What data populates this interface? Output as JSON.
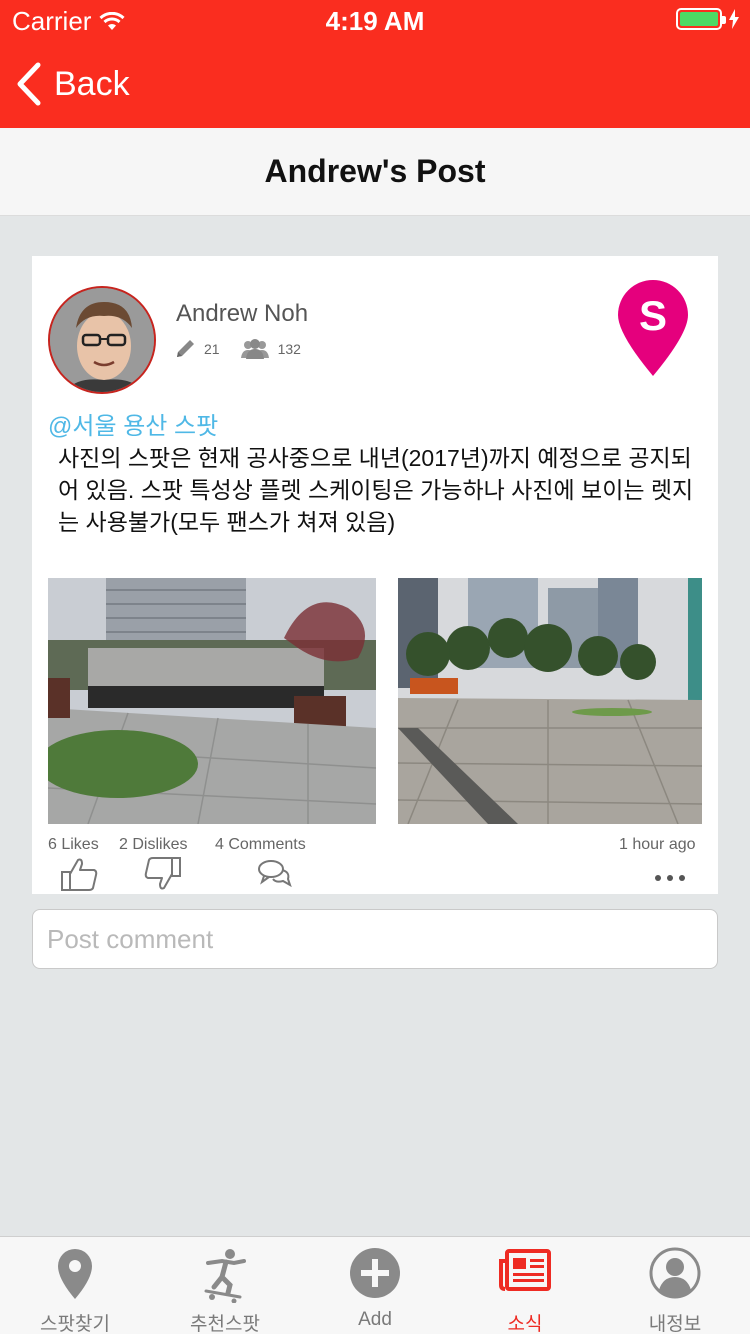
{
  "status_bar": {
    "carrier": "Carrier",
    "time": "4:19 AM"
  },
  "nav": {
    "back_label": "Back",
    "title": "Andrew's Post"
  },
  "post": {
    "author": "Andrew Noh",
    "posts_count": "21",
    "followers_count": "132",
    "spot_tag": "@서울 용산 스팟",
    "body": "사진의 스팟은 현재 공사중으로 내년(2017년)까지 예정으로 공지되어 있음. 스팟 특성상 플렛 스케이팅은 가능하나 사진에 보이는 렛지는 사용불가(모두 팬스가 쳐져 있음)",
    "likes": "6 Likes",
    "dislikes": "2 Dislikes",
    "comments": "4 Comments",
    "time_ago": "1 hour ago"
  },
  "comment": {
    "placeholder": "Post comment"
  },
  "tabs": [
    {
      "label": "스팟찾기",
      "icon": "map-pin-icon"
    },
    {
      "label": "추천스팟",
      "icon": "skater-icon"
    },
    {
      "label": "Add",
      "icon": "plus-circle-icon"
    },
    {
      "label": "소식",
      "icon": "newspaper-icon",
      "active": true
    },
    {
      "label": "내정보",
      "icon": "profile-icon"
    }
  ],
  "colors": {
    "brand_red": "#fa2d1f",
    "tag_blue": "#4fb8e6",
    "pin_magenta": "#e5007d",
    "active_tab": "#ee2b23"
  }
}
